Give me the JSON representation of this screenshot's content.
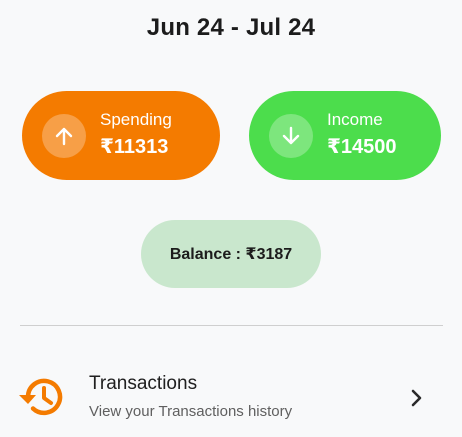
{
  "header": {
    "period": "Jun 24 - Jul 24"
  },
  "summary": {
    "spending": {
      "label": "Spending",
      "amount": "₹11313",
      "color": "#f47b00",
      "icon": "arrow-up-icon"
    },
    "income": {
      "label": "Income",
      "amount": "₹14500",
      "color": "#4cdd4c",
      "icon": "arrow-down-icon"
    },
    "balance": {
      "text": "Balance : ₹3187",
      "color": "#c9e7cd"
    }
  },
  "menu": {
    "transactions": {
      "title": "Transactions",
      "subtitle": "View your Transactions history",
      "icon": "history-icon",
      "icon_color": "#f47b00",
      "chevron": "chevron-right-icon"
    }
  }
}
